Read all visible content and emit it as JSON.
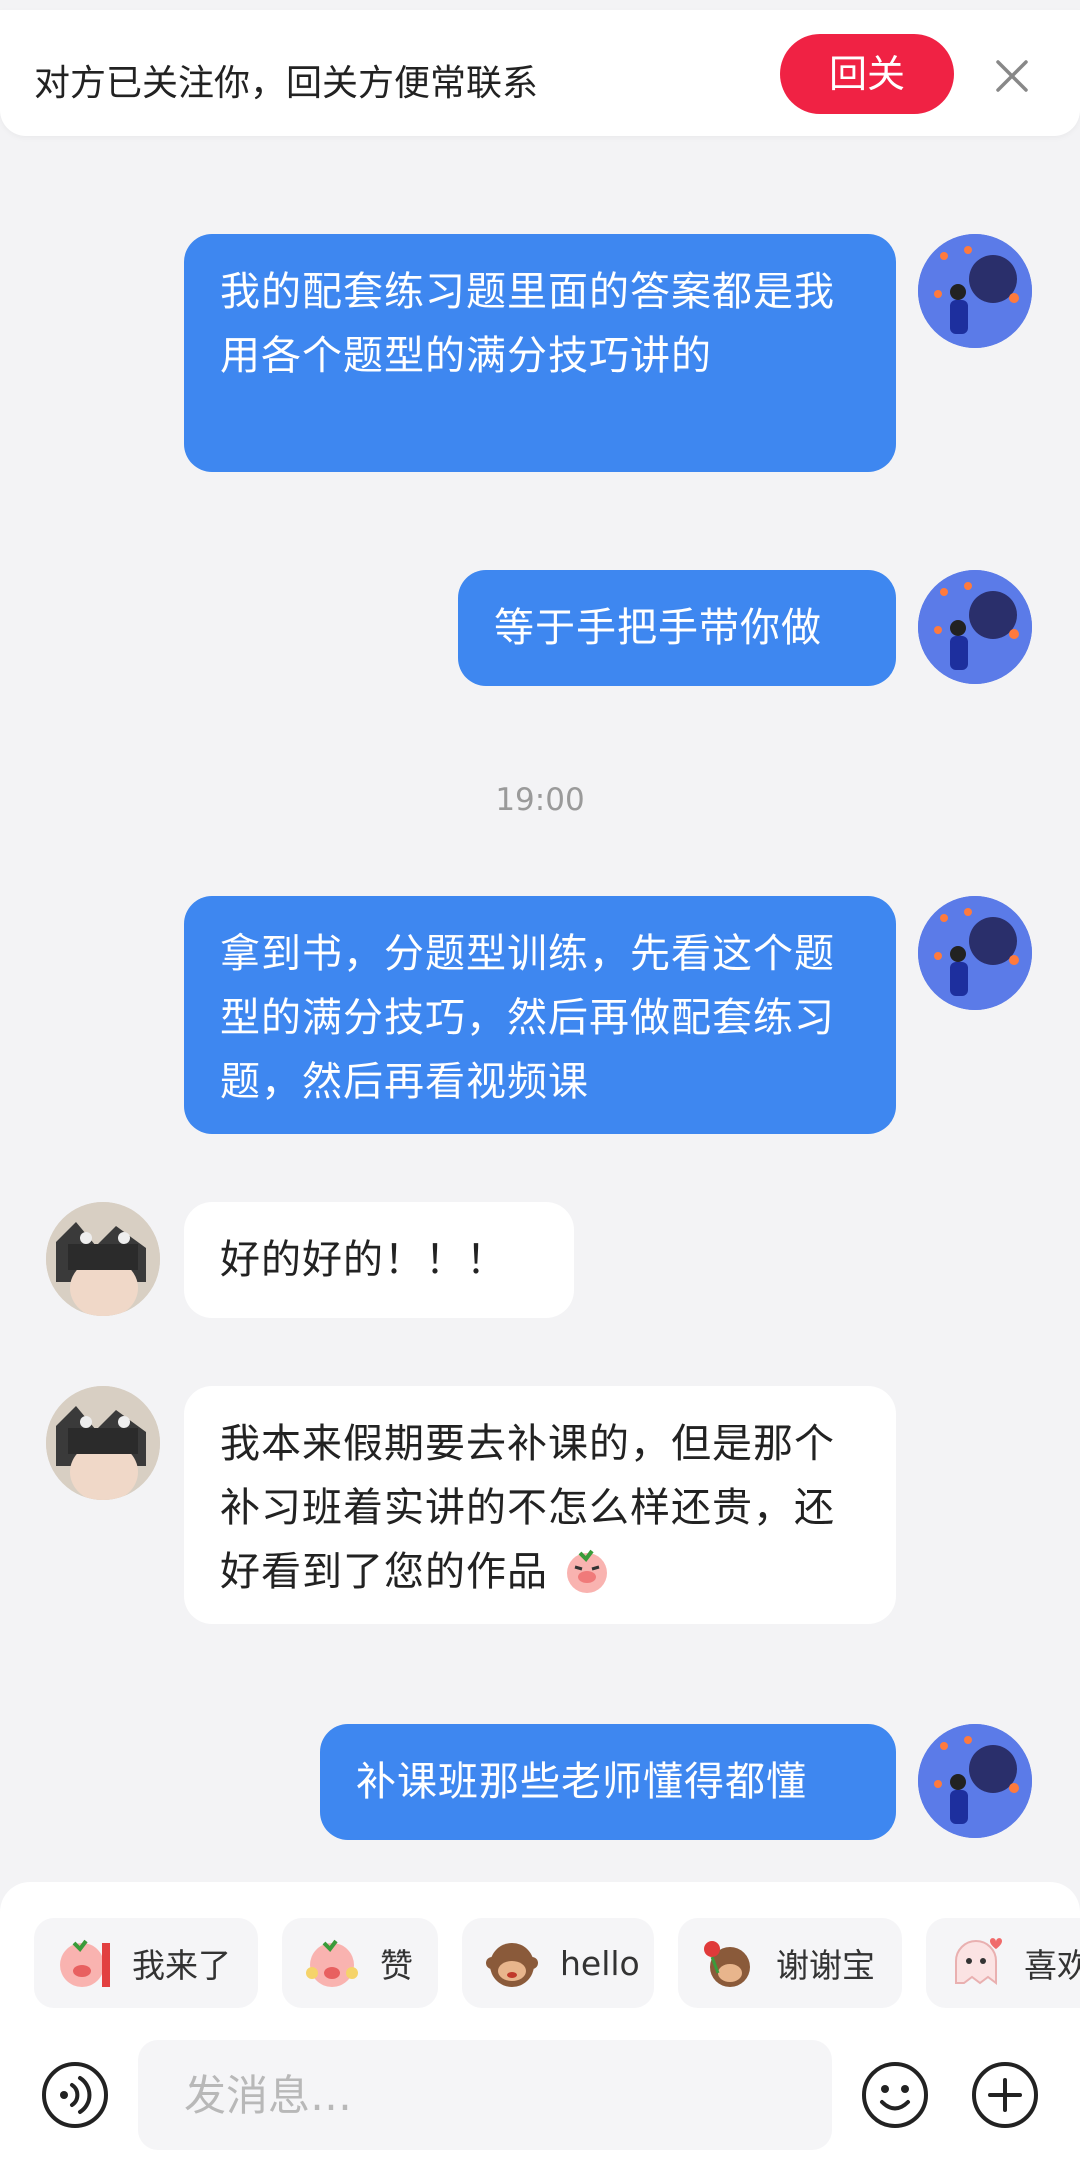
{
  "banner": {
    "text": "对方已关注你，回关方便常联系",
    "follow_label": "回关"
  },
  "messages": [
    {
      "side": "me",
      "text": "我的配套练习题里面的答案都是我用各个题型的满分技巧讲的"
    },
    {
      "side": "me",
      "text": "等于手把手带你做"
    },
    {
      "side": "me",
      "text": "拿到书，分题型训练，先看这个题型的满分技巧，然后再做配套练习题，然后再看视频课"
    },
    {
      "side": "them",
      "text": "好的好的！！！"
    },
    {
      "side": "them",
      "text": "我本来假期要去补课的，但是那个补习班着实讲的不怎么样还贵，还好看到了您的作品"
    },
    {
      "side": "me",
      "text": "补课班那些老师懂得都懂"
    }
  ],
  "timestamp": "19:00",
  "quick_replies": [
    {
      "label": "我来了",
      "icon": "pig-arrive-emoji"
    },
    {
      "label": "赞",
      "icon": "pig-clap-emoji"
    },
    {
      "label": "hello",
      "icon": "monkey-hello-emoji"
    },
    {
      "label": "谢谢宝",
      "icon": "monkey-rose-emoji"
    },
    {
      "label": "喜欢",
      "icon": "ghost-love-emoji"
    }
  ],
  "input": {
    "placeholder": "发消息…"
  },
  "colors": {
    "my_bubble": "#3e87f0",
    "follow_button": "#f02244",
    "background": "#f3f3f5"
  }
}
